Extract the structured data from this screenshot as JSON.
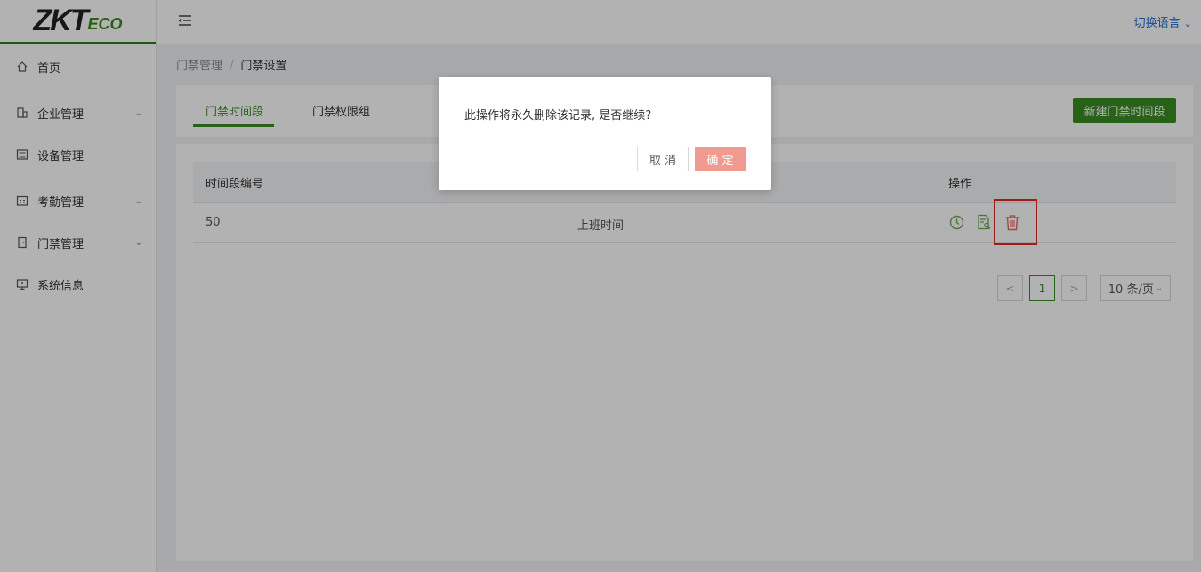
{
  "brand": {
    "logo_main": "ZKT",
    "logo_sub": "ECO"
  },
  "header": {
    "language_label": "切换语言"
  },
  "sidebar": {
    "items": [
      {
        "label": "首页",
        "icon": "home-icon",
        "expandable": false
      },
      {
        "label": "企业管理",
        "icon": "building-icon",
        "expandable": true
      },
      {
        "label": "设备管理",
        "icon": "device-icon",
        "expandable": false
      },
      {
        "label": "考勤管理",
        "icon": "calendar-icon",
        "expandable": true
      },
      {
        "label": "门禁管理",
        "icon": "door-icon",
        "expandable": true
      },
      {
        "label": "系统信息",
        "icon": "monitor-icon",
        "expandable": false
      }
    ]
  },
  "breadcrumb": {
    "parent": "门禁管理",
    "separator": "/",
    "current": "门禁设置"
  },
  "tabs": [
    {
      "label": "门禁时间段",
      "active": true
    },
    {
      "label": "门禁权限组",
      "active": false
    }
  ],
  "toolbar": {
    "new_button_label": "新建门禁时间段"
  },
  "table": {
    "columns": [
      "时间段编号",
      "操作"
    ],
    "rows": [
      {
        "id": "50",
        "name": "上班时间"
      }
    ]
  },
  "pagination": {
    "prev": "<",
    "current_page": "1",
    "next": ">",
    "page_size": "10 条/页"
  },
  "dialog": {
    "message": "此操作将永久删除该记录, 是否继续?",
    "cancel_label": "取 消",
    "confirm_label": "确 定"
  },
  "colors": {
    "primary": "#3b8c24",
    "link": "#1f6dd1",
    "danger": "#e02b20",
    "confirm_disabled": "#f19a8f"
  }
}
